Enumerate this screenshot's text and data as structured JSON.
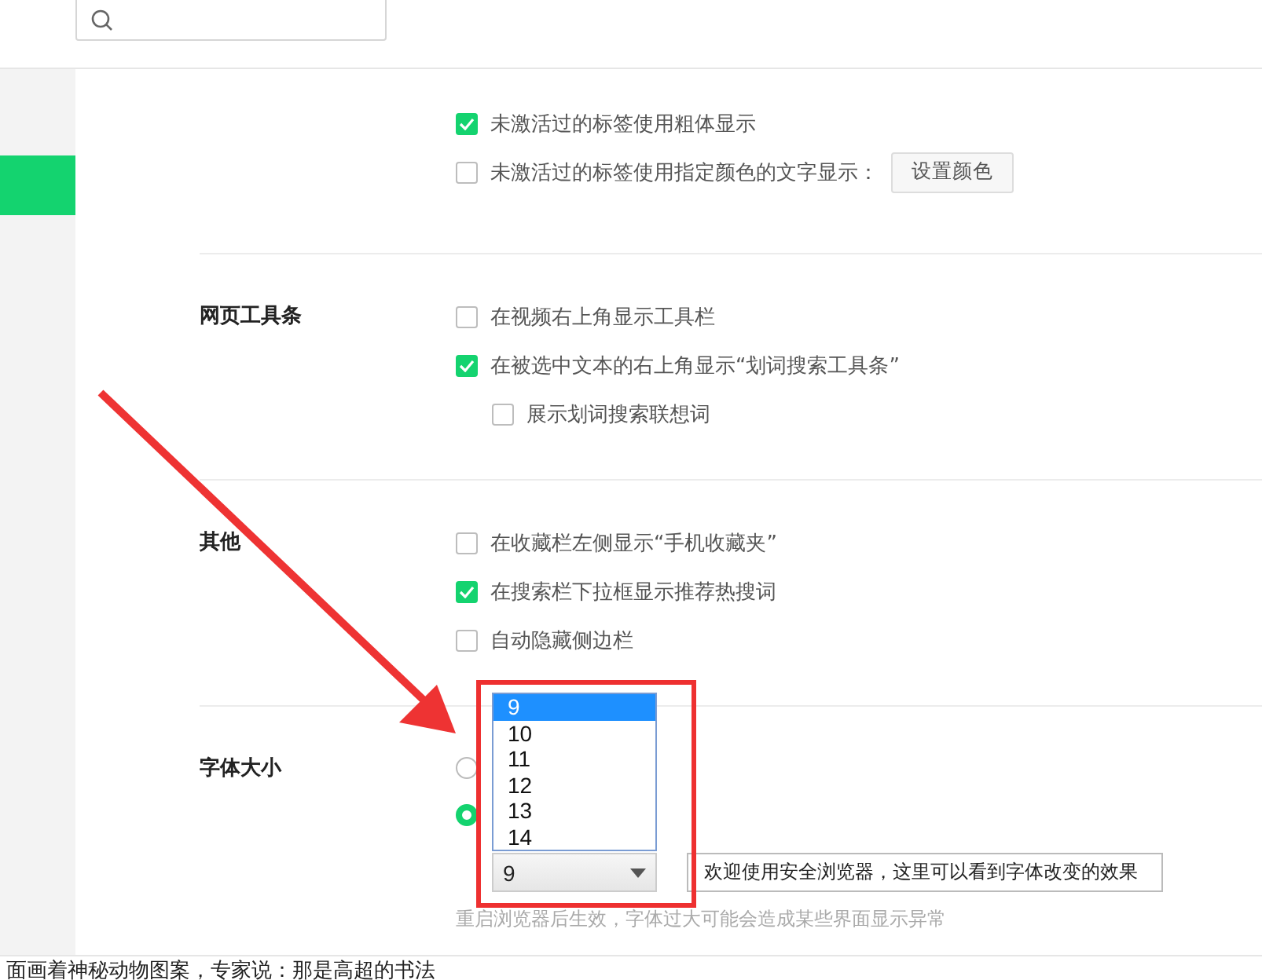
{
  "sidebar": {
    "items": [
      {
        "selected": true
      }
    ]
  },
  "sections": [
    {
      "options": [
        {
          "kind": "checkbox",
          "label": "未激活过的标签使用粗体显示",
          "checked": true
        },
        {
          "kind": "checkbox",
          "label": "未激活过的标签使用指定颜色的文字显示：",
          "checked": false,
          "button": "设置颜色"
        }
      ]
    },
    {
      "title": "网页工具条",
      "options": [
        {
          "kind": "checkbox",
          "label": "在视频右上角显示工具栏",
          "checked": false
        },
        {
          "kind": "checkbox",
          "label": "在被选中文本的右上角显示“划词搜索工具条”",
          "checked": true,
          "children": [
            {
              "kind": "checkbox",
              "label": "展示划词搜索联想词",
              "checked": false
            }
          ]
        }
      ]
    },
    {
      "title": "其他",
      "options": [
        {
          "kind": "checkbox",
          "label": "在收藏栏左侧显示“手机收藏夹”",
          "checked": false
        },
        {
          "kind": "checkbox",
          "label": "在搜索栏下拉框显示推荐热搜词",
          "checked": true
        },
        {
          "kind": "checkbox",
          "label": "自动隐藏侧边栏",
          "checked": false
        }
      ]
    },
    {
      "title": "字体大小",
      "radios": [
        {
          "selected": false
        },
        {
          "selected": true
        }
      ],
      "font_select": {
        "value": "9",
        "expanded": true,
        "options": [
          {
            "label": "9",
            "selected": true
          },
          {
            "label": "10",
            "selected": false
          },
          {
            "label": "11",
            "selected": false
          },
          {
            "label": "12",
            "selected": false
          },
          {
            "label": "13",
            "selected": false
          },
          {
            "label": "14",
            "selected": false
          }
        ]
      },
      "preview": "欢迎使用安全浏览器，这里可以看到字体改变的效果",
      "hint": "重启浏览器后生效，字体过大可能会造成某些界面显示异常"
    }
  ],
  "footer_text": "面画着神秘动物图案，专家说：那是高超的书法"
}
